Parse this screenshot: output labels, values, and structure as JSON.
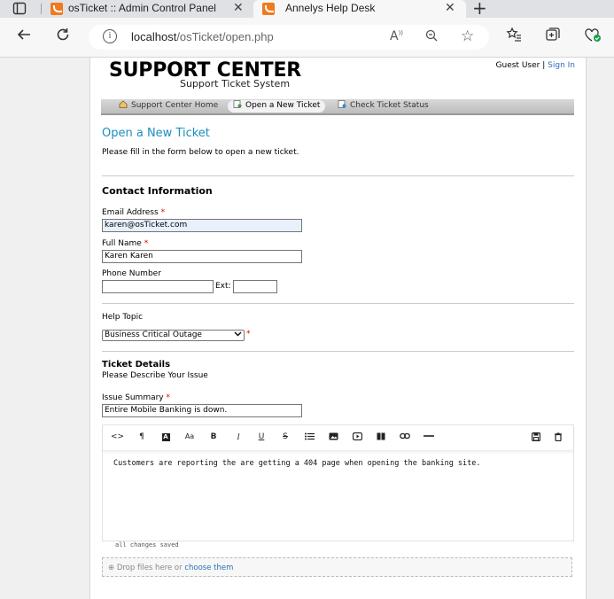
{
  "browser": {
    "tabs": [
      {
        "title": "osTicket :: Admin Control Panel",
        "active": false
      },
      {
        "title": "Annelys Help Desk",
        "active": true
      }
    ],
    "url_host": "localhost",
    "url_path": "/osTicket/open.php"
  },
  "header": {
    "logo_title": "SUPPORT CENTER",
    "logo_subtitle": "Support Ticket System",
    "guest_label": "Guest User",
    "separator": "|",
    "sign_in": "Sign In"
  },
  "nav": {
    "items": [
      {
        "label": "Support Center Home"
      },
      {
        "label": "Open a New Ticket"
      },
      {
        "label": "Check Ticket Status"
      }
    ]
  },
  "page": {
    "title": "Open a New Ticket",
    "intro": "Please fill in the form below to open a new ticket."
  },
  "contact": {
    "section_title": "Contact Information",
    "email_label": "Email Address",
    "email_value": "karen@osTicket.com",
    "name_label": "Full Name",
    "name_value": "Karen Karen",
    "phone_label": "Phone Number",
    "phone_value": "",
    "ext_label": "Ext:",
    "ext_value": "",
    "required_mark": "*"
  },
  "help_topic": {
    "label": "Help Topic",
    "selected": "Business Critical Outage"
  },
  "ticket": {
    "section_title": "Ticket Details",
    "section_subtitle": "Please Describe Your Issue",
    "summary_label": "Issue Summary",
    "summary_value": "Entire Mobile Banking is down.",
    "body": "Customers are reporting the are getting a 404 page when opening the banking site.",
    "status": "all changes saved",
    "drop_text": "Drop files here or",
    "drop_link": "choose them"
  },
  "colors": {
    "link": "#2a6fb8",
    "title": "#1a8fc0",
    "required": "#dd0000",
    "tab_favicon": "#f07a1e"
  }
}
